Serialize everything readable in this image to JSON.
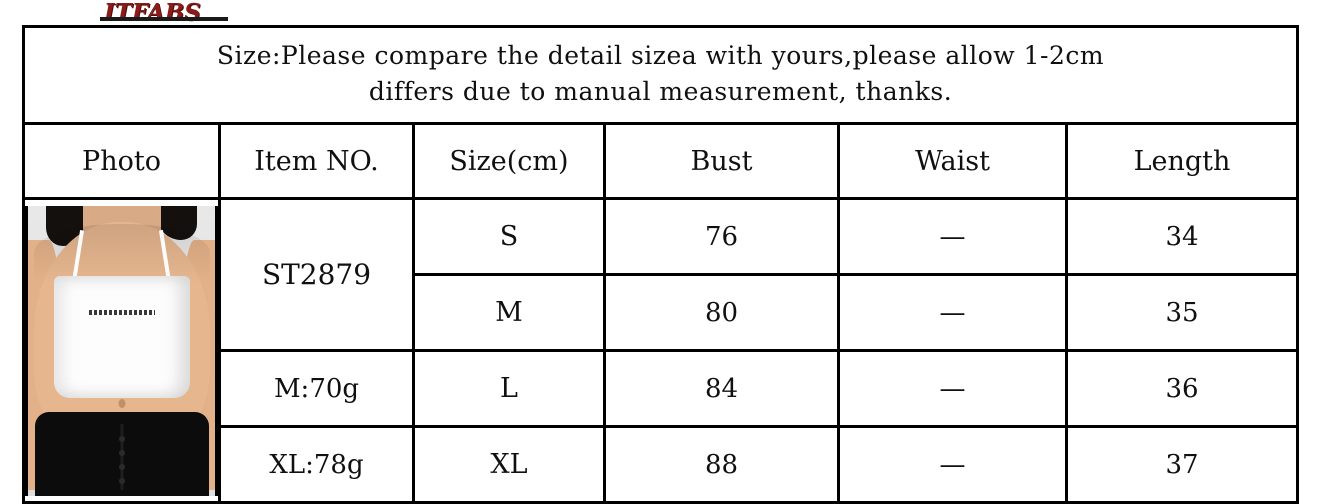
{
  "brand": {
    "name": "ITFABS",
    "color": "#8a1b18"
  },
  "notice": {
    "line1": "Size:Please compare the detail sizea with yours,please allow 1-2cm",
    "line2": "differs due to manual measurement, thanks."
  },
  "table": {
    "headers": {
      "photo": "Photo",
      "item_no": "Item NO.",
      "size": "Size(cm)",
      "bust": "Bust",
      "waist": "Waist",
      "length": "Length"
    },
    "item_no_cells": {
      "code": "ST2879",
      "weight_m": "M:70g",
      "weight_xl": "XL:78g"
    },
    "rows": [
      {
        "size": "S",
        "bust": "76",
        "waist": "—",
        "length": "34"
      },
      {
        "size": "M",
        "bust": "80",
        "waist": "—",
        "length": "35"
      },
      {
        "size": "L",
        "bust": "84",
        "waist": "—",
        "length": "36"
      },
      {
        "size": "XL",
        "bust": "88",
        "waist": "—",
        "length": "37"
      }
    ]
  },
  "photo": {
    "description": "product-photo-white-crop-camisole"
  }
}
